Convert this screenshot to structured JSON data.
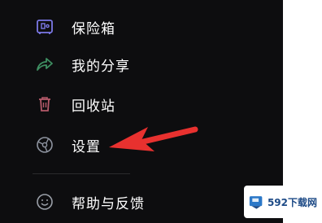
{
  "menu": {
    "items": [
      {
        "label": "保险箱",
        "icon": "safe-icon"
      },
      {
        "label": "我的分享",
        "icon": "share-icon"
      },
      {
        "label": "回收站",
        "icon": "trash-icon"
      },
      {
        "label": "设置",
        "icon": "settings-icon"
      },
      {
        "label": "帮助与反馈",
        "icon": "help-feedback-icon"
      }
    ]
  },
  "annotation": {
    "type": "red-arrow",
    "points_to": "设置",
    "color": "#e8312f"
  },
  "watermark": {
    "text": "592下载网"
  },
  "colors": {
    "background": "#0d0d0f",
    "text": "#ffffff",
    "safe_icon": "#7b78e6",
    "share_icon": "#3e8f62",
    "trash_icon": "#b55a6a",
    "settings_icon": "#8e94a0",
    "help_icon": "#9a9fa8"
  }
}
